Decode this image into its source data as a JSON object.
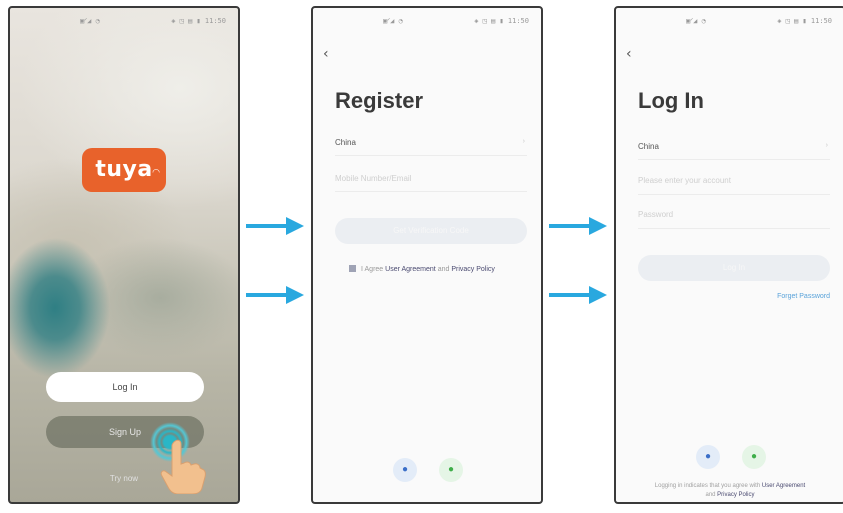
{
  "status_bar": {
    "left": "▣ᐟ◢ ◔",
    "right": "◈ ◳ ▤ ▮ 11:50"
  },
  "splash": {
    "logo_text": "tuya",
    "login_button": "Log In",
    "signup_button": "Sign Up",
    "try_now": "Try now"
  },
  "register": {
    "back": "‹",
    "title": "Register",
    "country": "China",
    "country_caret": "›",
    "account_placeholder": "Mobile Number/Email",
    "get_code_button": "Get Verification Code",
    "agree_prefix": "I Agree",
    "user_agreement": "User Agreement",
    "and": "and",
    "privacy_policy": "Privacy Policy"
  },
  "login": {
    "back": "‹",
    "title": "Log In",
    "country": "China",
    "country_caret": "›",
    "account_placeholder": "Please enter your account",
    "password_placeholder": "Password",
    "login_button": "Log In",
    "forgot_password": "Forget Password",
    "footer_prefix": "Logging in indicates that you agree with",
    "user_agreement": "User Agreement",
    "and": "and",
    "privacy_policy": "Privacy Policy"
  },
  "social": {
    "left_icon": "●",
    "right_icon": "●"
  },
  "colors": {
    "arrow": "#29a8df",
    "tuya_orange": "#e8622b",
    "tap_ring": "#2ab6c6"
  }
}
